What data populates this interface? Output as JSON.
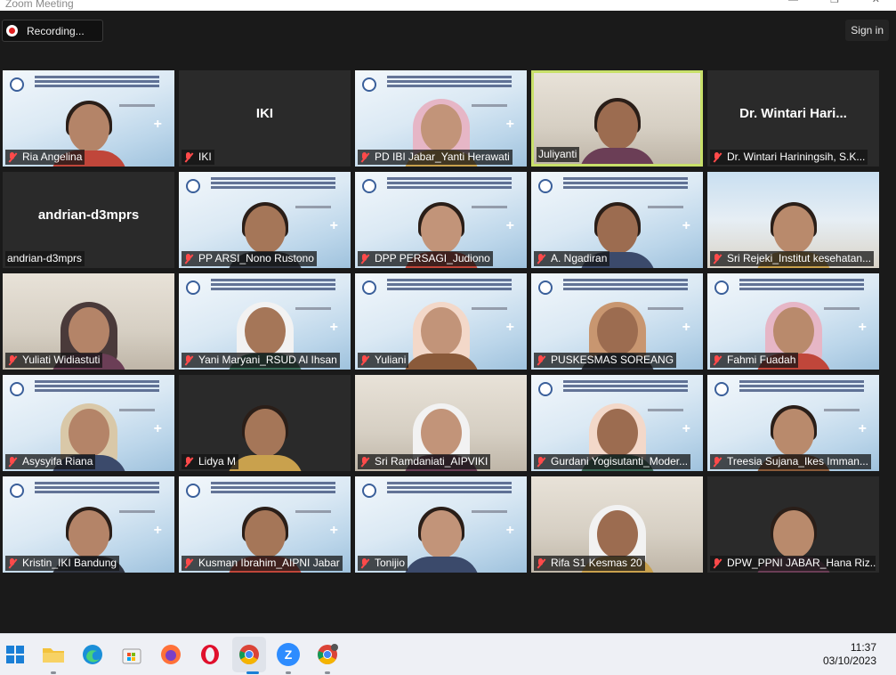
{
  "window": {
    "title": "Zoom Meeting"
  },
  "recording": {
    "label": "Recording..."
  },
  "header": {
    "sign_in": "Sign in"
  },
  "participants": [
    {
      "name": "Ria Angelina",
      "display": "",
      "scene": "slide",
      "muted": true
    },
    {
      "name": "IKI",
      "display": "IKI",
      "scene": "dark",
      "muted": true
    },
    {
      "name": "PD IBI Jabar_Yanti Herawati",
      "display": "",
      "scene": "slide",
      "muted": true
    },
    {
      "name": "Juliyanti",
      "display": "",
      "scene": "room",
      "muted": false,
      "active": true
    },
    {
      "name": "Dr. Wintari Hariningsih, S.K...",
      "display": "Dr. Wintari Hari...",
      "scene": "dark",
      "muted": true
    },
    {
      "name": "andrian-d3mprs",
      "display": "andrian-d3mprs",
      "scene": "dark",
      "muted": false
    },
    {
      "name": "PP ARSI_Nono Rustono",
      "display": "",
      "scene": "slide",
      "muted": true
    },
    {
      "name": "DPP PERSAGI_Judiono",
      "display": "",
      "scene": "slide",
      "muted": true
    },
    {
      "name": "A. Ngadiran",
      "display": "",
      "scene": "slide",
      "muted": true
    },
    {
      "name": "Sri Rejeki_Institut kesehatan...",
      "display": "",
      "scene": "beach",
      "muted": true
    },
    {
      "name": "Yuliati Widiastuti",
      "display": "",
      "scene": "room",
      "muted": true
    },
    {
      "name": "Yani Maryani_RSUD Al Ihsan",
      "display": "",
      "scene": "slide",
      "muted": true
    },
    {
      "name": "Yuliani",
      "display": "",
      "scene": "slide",
      "muted": true
    },
    {
      "name": "PUSKESMAS SOREANG",
      "display": "",
      "scene": "slide",
      "muted": true
    },
    {
      "name": "Fahmi Fuadah",
      "display": "",
      "scene": "slide",
      "muted": true
    },
    {
      "name": "Asysyifa Riana",
      "display": "",
      "scene": "slide",
      "muted": true
    },
    {
      "name": "Lidya M",
      "display": "",
      "scene": "dark",
      "muted": true
    },
    {
      "name": "Sri Ramdaniati_AIPVIKI",
      "display": "",
      "scene": "room",
      "muted": true
    },
    {
      "name": "Gurdani Yogisutanti_Moder...",
      "display": "",
      "scene": "slide",
      "muted": true
    },
    {
      "name": "Treesia Sujana_Ikes Imman...",
      "display": "",
      "scene": "slide",
      "muted": true
    },
    {
      "name": "Kristin_IKI Bandung",
      "display": "",
      "scene": "slide",
      "muted": true
    },
    {
      "name": "Kusman Ibrahim_AIPNI Jabar",
      "display": "",
      "scene": "slide",
      "muted": true
    },
    {
      "name": "Tonijio",
      "display": "",
      "scene": "slide",
      "muted": true
    },
    {
      "name": "Rifa S1 Kesmas 20",
      "display": "",
      "scene": "room",
      "muted": true
    },
    {
      "name": "DPW_PPNI JABAR_Hana Riz...",
      "display": "",
      "scene": "dark",
      "muted": true
    }
  ],
  "taskbar": {
    "icons": [
      "windows-start-icon",
      "file-explorer-icon",
      "edge-icon",
      "store-icon",
      "firefox-icon",
      "opera-icon",
      "chrome-icon",
      "zoom-icon",
      "chrome-profile-icon"
    ],
    "time": "11:37",
    "date": "03/10/2023"
  },
  "colors": {
    "active_speaker_border": "#c8e06a",
    "muted_mic": "#ff4a4a",
    "background": "#1a1a1a"
  }
}
